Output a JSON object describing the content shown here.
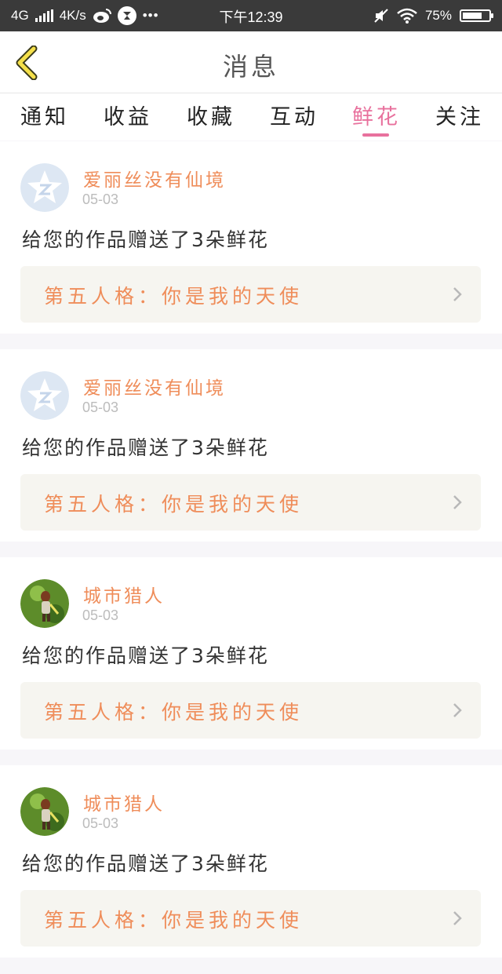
{
  "status_bar": {
    "network": "4G",
    "speed": "4K/s",
    "time": "下午12:39",
    "battery": "75%",
    "battery_level": 0.75
  },
  "header": {
    "title": "消息"
  },
  "tabs": [
    {
      "label": "通知",
      "active": false
    },
    {
      "label": "收益",
      "active": false
    },
    {
      "label": "收藏",
      "active": false
    },
    {
      "label": "互动",
      "active": false
    },
    {
      "label": "鲜花",
      "active": true
    },
    {
      "label": "关注",
      "active": false
    }
  ],
  "items": [
    {
      "user": "爱丽丝没有仙境",
      "date": "05-03",
      "avatar": "default-qq-avatar-icon",
      "message": "给您的作品赠送了3朵鲜花",
      "work_title": "第五人格：你是我的天使"
    },
    {
      "user": "爱丽丝没有仙境",
      "date": "05-03",
      "avatar": "default-qq-avatar-icon",
      "message": "给您的作品赠送了3朵鲜花",
      "work_title": "第五人格：你是我的天使"
    },
    {
      "user": "城市猎人",
      "date": "05-03",
      "avatar": "game-character-avatar",
      "message": "给您的作品赠送了3朵鲜花",
      "work_title": "第五人格：你是我的天使"
    },
    {
      "user": "城市猎人",
      "date": "05-03",
      "avatar": "game-character-avatar",
      "message": "给您的作品赠送了3朵鲜花",
      "work_title": "第五人格：你是我的天使"
    }
  ],
  "colors": {
    "accent": "#e8719d",
    "username": "#ef8d5a",
    "back_arrow": "#f5e04a"
  }
}
